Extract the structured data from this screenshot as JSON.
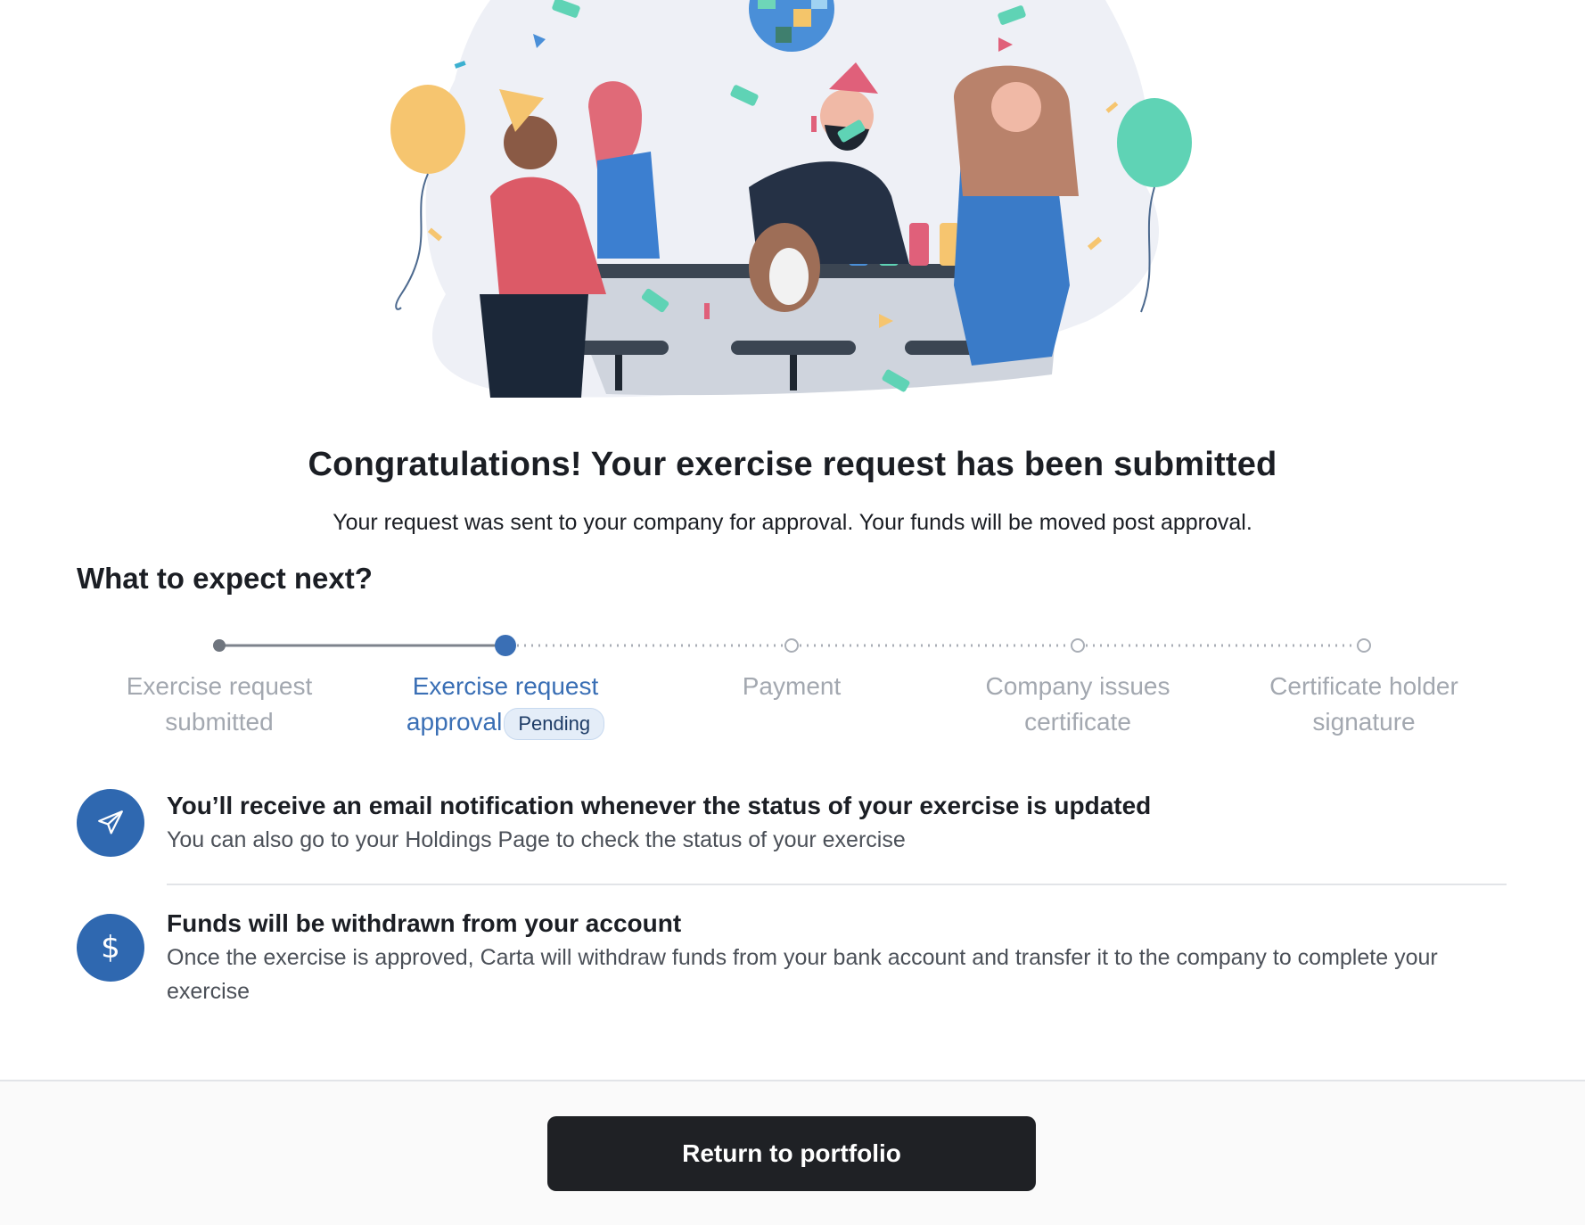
{
  "confirmation": {
    "title": "Congratulations! Your exercise request has been submitted",
    "subtitle": "Your request was sent to your company for approval. Your funds will be moved post approval."
  },
  "next_steps": {
    "heading": "What to expect next?",
    "current_step_index": 1,
    "steps": [
      {
        "line1": "Exercise request",
        "line2": "submitted",
        "state": "complete"
      },
      {
        "line1": "Exercise request",
        "line2": "approval",
        "state": "current",
        "badge": "Pending"
      },
      {
        "line1": "Payment",
        "line2": "",
        "state": "upcoming"
      },
      {
        "line1": "Company issues",
        "line2": "certificate",
        "state": "upcoming"
      },
      {
        "line1": "Certificate holder",
        "line2": "signature",
        "state": "upcoming"
      }
    ]
  },
  "info": [
    {
      "icon": "paper-plane-icon",
      "title": "You’ll receive an email notification whenever the status of your exercise is updated",
      "body": "You can also go to your Holdings Page to check the status of your exercise"
    },
    {
      "icon": "dollar-icon",
      "title": "Funds will be withdrawn from your account",
      "body": "Once the exercise is approved, Carta will withdraw funds from your bank account and transfer it to the company to complete your exercise"
    }
  ],
  "footer": {
    "return_label": "Return to portfolio"
  },
  "colors": {
    "accent": "#3a6fb5",
    "icon_circle": "#2f68b0",
    "button_bg": "#1f2125",
    "muted_text": "#a3a8b0"
  }
}
